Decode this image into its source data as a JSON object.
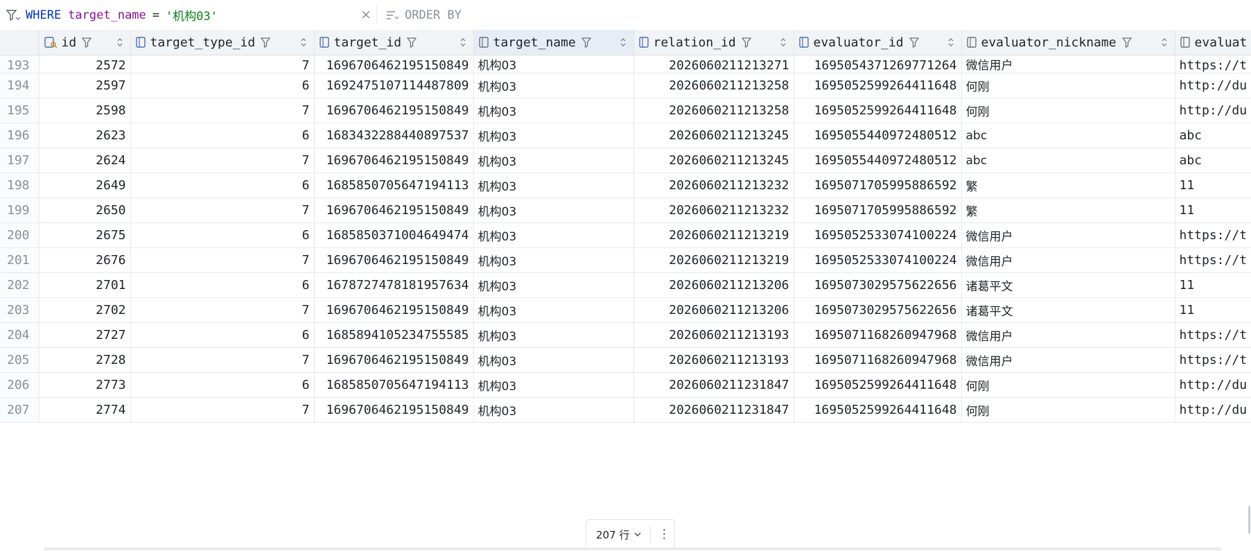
{
  "filter": {
    "keyword": "WHERE",
    "column": "target_name",
    "operator": "=",
    "value": "'机构03'",
    "clear_label": "×",
    "order_label": "ORDER BY"
  },
  "columns": [
    {
      "name": "id",
      "icon": "key-column-icon"
    },
    {
      "name": "target_type_id",
      "icon": "column-icon"
    },
    {
      "name": "target_id",
      "icon": "column-icon"
    },
    {
      "name": "target_name",
      "icon": "column-icon"
    },
    {
      "name": "relation_id",
      "icon": "column-icon"
    },
    {
      "name": "evaluator_id",
      "icon": "column-icon"
    },
    {
      "name": "evaluator_nickname",
      "icon": "text-column-icon"
    },
    {
      "name": "evaluat",
      "icon": "text-column-icon"
    }
  ],
  "rows": [
    [
      "193",
      "2572",
      "7",
      "1696706462195150849",
      "机构03",
      "2026060211213271",
      "1695054371269771264",
      "微信用户",
      "https://t"
    ],
    [
      "194",
      "2597",
      "6",
      "1692475107114487809",
      "机构03",
      "2026060211213258",
      "1695052599264411648",
      "何刚",
      "http://du"
    ],
    [
      "195",
      "2598",
      "7",
      "1696706462195150849",
      "机构03",
      "2026060211213258",
      "1695052599264411648",
      "何刚",
      "http://du"
    ],
    [
      "196",
      "2623",
      "6",
      "1683432288440897537",
      "机构03",
      "2026060211213245",
      "1695055440972480512",
      "abc",
      "abc"
    ],
    [
      "197",
      "2624",
      "7",
      "1696706462195150849",
      "机构03",
      "2026060211213245",
      "1695055440972480512",
      "abc",
      "abc"
    ],
    [
      "198",
      "2649",
      "6",
      "1685850705647194113",
      "机构03",
      "2026060211213232",
      "1695071705995886592",
      "繁",
      "11"
    ],
    [
      "199",
      "2650",
      "7",
      "1696706462195150849",
      "机构03",
      "2026060211213232",
      "1695071705995886592",
      "繁",
      "11"
    ],
    [
      "200",
      "2675",
      "6",
      "1685850371004649474",
      "机构03",
      "2026060211213219",
      "1695052533074100224",
      "微信用户",
      "https://t"
    ],
    [
      "201",
      "2676",
      "7",
      "1696706462195150849",
      "机构03",
      "2026060211213219",
      "1695052533074100224",
      "微信用户",
      "https://t"
    ],
    [
      "202",
      "2701",
      "6",
      "1678727478181957634",
      "机构03",
      "2026060211213206",
      "1695073029575622656",
      "诸葛平文",
      "11"
    ],
    [
      "203",
      "2702",
      "7",
      "1696706462195150849",
      "机构03",
      "2026060211213206",
      "1695073029575622656",
      "诸葛平文",
      "11"
    ],
    [
      "204",
      "2727",
      "6",
      "1685894105234755585",
      "机构03",
      "2026060211213193",
      "1695071168260947968",
      "微信用户",
      "https://t"
    ],
    [
      "205",
      "2728",
      "7",
      "1696706462195150849",
      "机构03",
      "2026060211213193",
      "1695071168260947968",
      "微信用户",
      "https://t"
    ],
    [
      "206",
      "2773",
      "6",
      "1685850705647194113",
      "机构03",
      "2026060211231847",
      "1695052599264411648",
      "何刚",
      "http://du"
    ],
    [
      "207",
      "2774",
      "7",
      "1696706462195150849",
      "机构03",
      "2026060211231847",
      "1695052599264411648",
      "何刚",
      "http://du"
    ]
  ],
  "pager": {
    "rows_label": "207 行",
    "more_label": "⋮"
  }
}
